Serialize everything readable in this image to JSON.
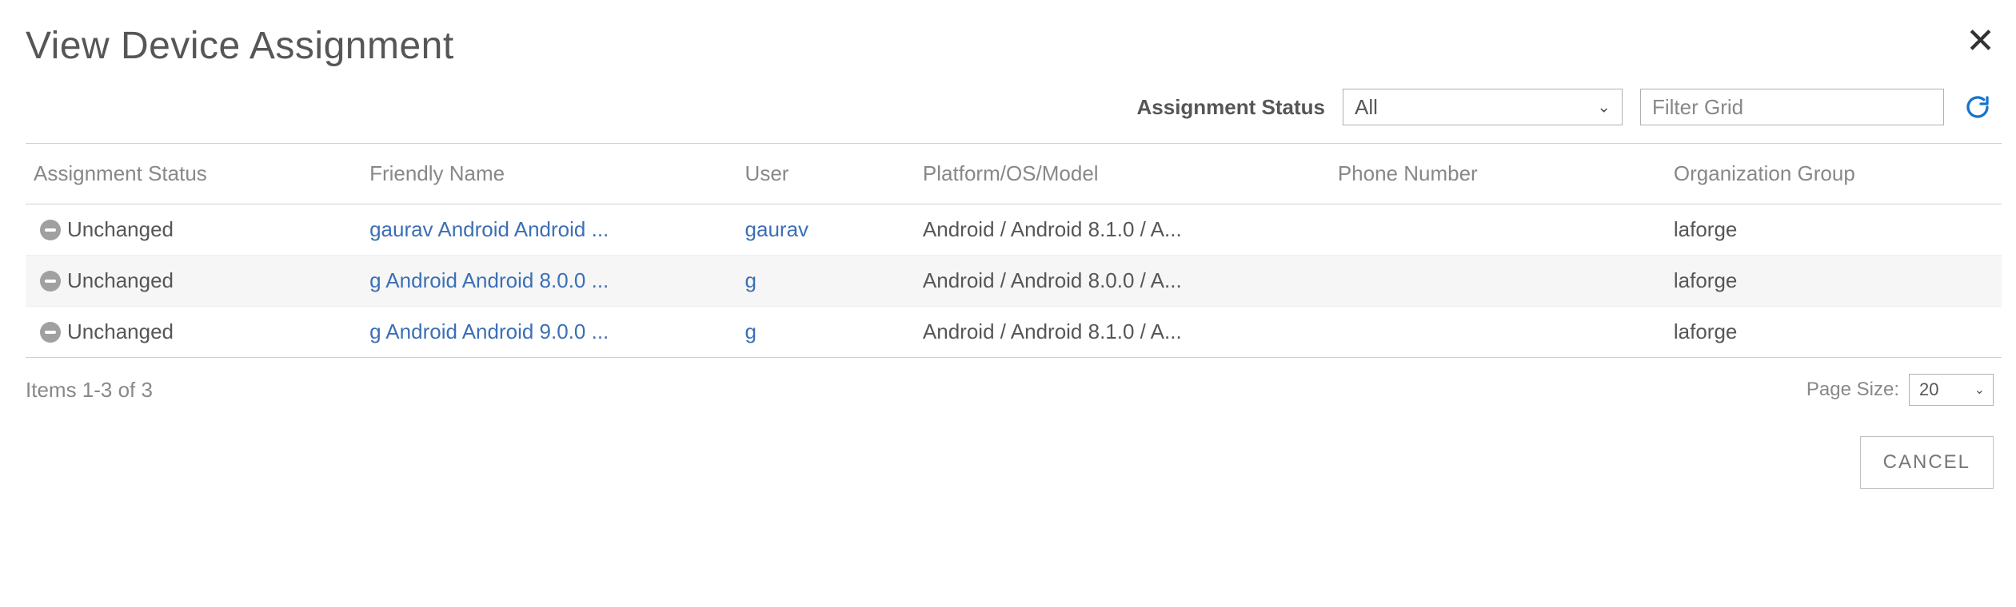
{
  "title": "View Device Assignment",
  "filter": {
    "label": "Assignment Status",
    "selected": "All",
    "placeholder": "Filter Grid"
  },
  "columns": {
    "status": "Assignment Status",
    "friendly": "Friendly Name",
    "user": "User",
    "platform": "Platform/OS/Model",
    "phone": "Phone Number",
    "org": "Organization Group"
  },
  "rows": [
    {
      "status": "Unchanged",
      "friendly": "gaurav Android Android ...",
      "user": "gaurav",
      "platform": "Android / Android 8.1.0 / A...",
      "phone": "",
      "org": "laforge"
    },
    {
      "status": "Unchanged",
      "friendly": "g Android Android 8.0.0 ...",
      "user": "g",
      "platform": "Android / Android 8.0.0 / A...",
      "phone": "",
      "org": "laforge"
    },
    {
      "status": "Unchanged",
      "friendly": "g Android Android 9.0.0 ...",
      "user": "g",
      "platform": "Android / Android 8.1.0 / A...",
      "phone": "",
      "org": "laforge"
    }
  ],
  "footer": {
    "items": "Items 1-3 of 3",
    "pageSizeLabel": "Page Size:",
    "pageSize": "20"
  },
  "actions": {
    "cancel": "CANCEL"
  }
}
